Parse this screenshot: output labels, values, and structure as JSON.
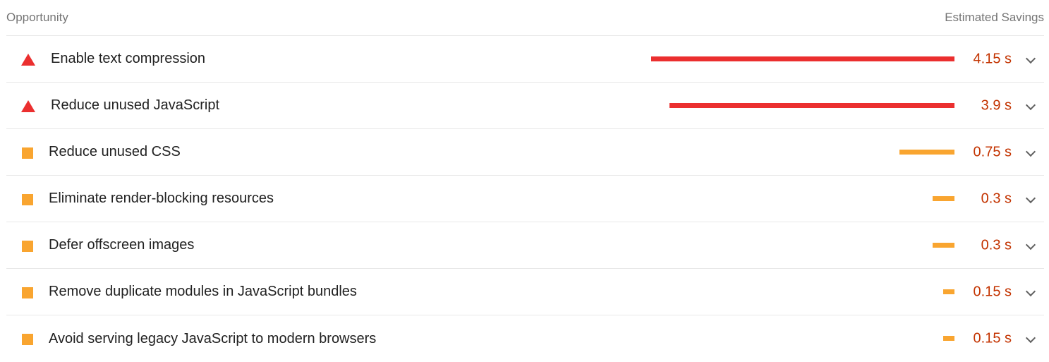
{
  "header": {
    "left_label": "Opportunity",
    "right_label": "Estimated Savings"
  },
  "colors": {
    "fail": "#eb2f2f",
    "average": "#f9a530",
    "value_text": "#c33300"
  },
  "opportunities": [
    {
      "title": "Enable text compression",
      "savings": "4.15 s",
      "savings_seconds": 4.15,
      "severity": "fail",
      "icon": "warning-triangle-icon"
    },
    {
      "title": "Reduce unused JavaScript",
      "savings": "3.9 s",
      "savings_seconds": 3.9,
      "severity": "fail",
      "icon": "warning-triangle-icon"
    },
    {
      "title": "Reduce unused CSS",
      "savings": "0.75 s",
      "savings_seconds": 0.75,
      "severity": "average",
      "icon": "average-square-icon"
    },
    {
      "title": "Eliminate render-blocking resources",
      "savings": "0.3 s",
      "savings_seconds": 0.3,
      "severity": "average",
      "icon": "average-square-icon"
    },
    {
      "title": "Defer offscreen images",
      "savings": "0.3 s",
      "savings_seconds": 0.3,
      "severity": "average",
      "icon": "average-square-icon"
    },
    {
      "title": "Remove duplicate modules in JavaScript bundles",
      "savings": "0.15 s",
      "savings_seconds": 0.15,
      "severity": "average",
      "icon": "average-square-icon"
    },
    {
      "title": "Avoid serving legacy JavaScript to modern browsers",
      "savings": "0.15 s",
      "savings_seconds": 0.15,
      "severity": "average",
      "icon": "average-square-icon"
    }
  ]
}
